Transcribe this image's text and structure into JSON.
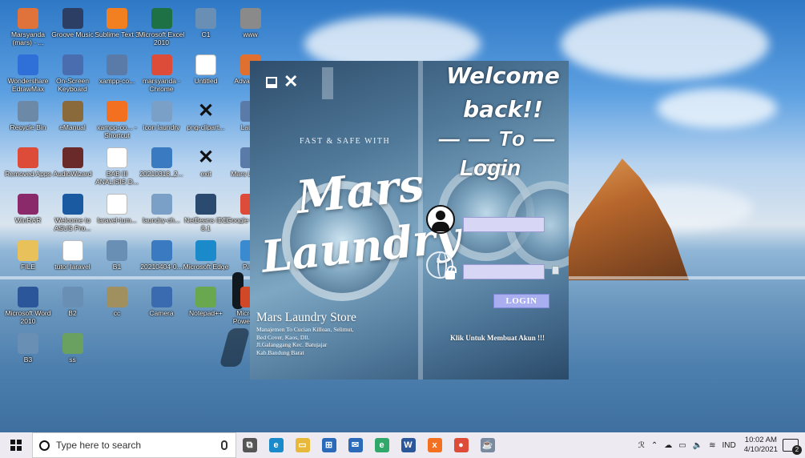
{
  "desktop": {
    "icons": [
      {
        "label": "Marsyanda (mars) - ...",
        "icon": "user-folder-icon",
        "color": "#e0733b"
      },
      {
        "label": "Groove Music",
        "icon": "groove-music-icon",
        "color": "#2c3e63"
      },
      {
        "label": "Sublime Text 3",
        "icon": "sublime-text-icon",
        "color": "#f38020"
      },
      {
        "label": "Microsoft Excel 2010",
        "icon": "excel-icon",
        "color": "#1e7145"
      },
      {
        "label": "C1",
        "icon": "document-icon",
        "color": "#6a8fb5"
      },
      {
        "label": "www",
        "icon": "folder-icon",
        "color": "#8a8a8a"
      },
      {
        "label": "Wondershare EdrawMax",
        "icon": "edrawmax-icon",
        "color": "#2f6fd8"
      },
      {
        "label": "On-Screen Keyboard",
        "icon": "keyboard-icon",
        "color": "#4a6db0"
      },
      {
        "label": "xampp-co...",
        "icon": "shortcut-icon",
        "color": "#5a7aa8"
      },
      {
        "label": "marsyanda - Chrome",
        "icon": "chrome-icon",
        "color": "#dd4b39"
      },
      {
        "label": "Untitled",
        "icon": "blank-document-icon",
        "color": "#ffffff"
      },
      {
        "label": "Adva Insta",
        "icon": "installer-icon",
        "color": "#e07030"
      },
      {
        "label": "Recycle Bin",
        "icon": "recycle-bin-icon",
        "color": "#6c8aa8"
      },
      {
        "label": "eManual",
        "icon": "manual-icon",
        "color": "#8a6a3a"
      },
      {
        "label": "xampp-co... - Shortcut",
        "icon": "xampp-icon",
        "color": "#f37021"
      },
      {
        "label": "icon laundry",
        "icon": "image-icon",
        "color": "#7aa0c8"
      },
      {
        "label": "png-clipart...",
        "icon": "close-x-icon",
        "color": "#111111"
      },
      {
        "label": "Laund",
        "icon": "folder-icon",
        "color": "#5a7aa8"
      },
      {
        "label": "Removed Apps",
        "icon": "chrome-icon",
        "color": "#dd4b39"
      },
      {
        "label": "AudioWizard",
        "icon": "audio-icon",
        "color": "#6b2a2a"
      },
      {
        "label": "BAB III ANALISIS D...",
        "icon": "pdf-icon",
        "color": "#ffffff"
      },
      {
        "label": "20210318_2...",
        "icon": "zip-icon",
        "color": "#3a7ac0"
      },
      {
        "label": "exit",
        "icon": "close-x-icon",
        "color": "#111111"
      },
      {
        "label": "Mars L - Sho",
        "icon": "shortcut-icon",
        "color": "#5a7aa8"
      },
      {
        "label": "WinRAR",
        "icon": "winrar-icon",
        "color": "#8a2a6a"
      },
      {
        "label": "Welcome to ASUS Pro...",
        "icon": "asus-icon",
        "color": "#1a5aa0"
      },
      {
        "label": "laravel-tum...",
        "icon": "pdf-icon",
        "color": "#ffffff"
      },
      {
        "label": "laundry-ch...",
        "icon": "image-icon",
        "color": "#7aa0c8"
      },
      {
        "label": "NetBeans IDE 8.1",
        "icon": "netbeans-icon",
        "color": "#2a4a70"
      },
      {
        "label": "Google Chrome",
        "icon": "chrome-icon",
        "color": "#dd4b39"
      },
      {
        "label": "FILE",
        "icon": "folder-icon",
        "color": "#e8c15a"
      },
      {
        "label": "tutor laravel",
        "icon": "document-icon",
        "color": "#ffffff"
      },
      {
        "label": "B1",
        "icon": "document-icon",
        "color": "#6a8fb5"
      },
      {
        "label": "20210404-0...",
        "icon": "zip-icon",
        "color": "#3a7ac0"
      },
      {
        "label": "Microsoft Edge",
        "icon": "edge-icon",
        "color": "#1a8acb"
      },
      {
        "label": "Paint",
        "icon": "paint-icon",
        "color": "#3a8ad0"
      },
      {
        "label": "Microsoft Word 2010",
        "icon": "word-icon",
        "color": "#2b579a"
      },
      {
        "label": "B2",
        "icon": "document-icon",
        "color": "#6a8fb5"
      },
      {
        "label": "cc",
        "icon": "image-icon",
        "color": "#a09060"
      },
      {
        "label": "Camera",
        "icon": "camera-icon",
        "color": "#3a6ab0"
      },
      {
        "label": "Notepad++",
        "icon": "notepad-icon",
        "color": "#6aa84f"
      },
      {
        "label": "Microsoft PowerPoi...",
        "icon": "powerpoint-icon",
        "color": "#d24726"
      },
      {
        "label": "B3",
        "icon": "document-icon",
        "color": "#6a8fb5"
      },
      {
        "label": "ss",
        "icon": "image-icon",
        "color": "#6aa060"
      }
    ]
  },
  "login": {
    "tagline": "FAST & SAFE WITH",
    "brand_line1": "Mars",
    "brand_line2": "Laundry",
    "welcome_line1": "Welcome",
    "welcome_line2": "back!!",
    "to_line": "— — To — —",
    "login_word": "Login",
    "username_value": "",
    "password_value": "",
    "login_button": "LOGIN",
    "store_title": "Mars Laundry Store",
    "store_description": "Manajemen To Cucian Killoan, Selimut,\nBed Cover, Kaos, Dll.\nJl.Galanggang Kec. Batujajar\nKab.Bandung Barat",
    "signup_link": "Klik Untuk Membuat Akun !!!",
    "accent_color": "#a9aef1",
    "field_color": "#d7d6f5"
  },
  "taskbar": {
    "search_placeholder": "Type here to search",
    "apps": [
      {
        "icon": "task-view-icon",
        "label": "⧉",
        "color": "#555555"
      },
      {
        "icon": "edge-icon",
        "label": "e",
        "color": "#1a8acb"
      },
      {
        "icon": "file-explorer-icon",
        "label": "▭",
        "color": "#e8b83a"
      },
      {
        "icon": "store-icon",
        "label": "⊞",
        "color": "#2a6ab8"
      },
      {
        "icon": "mail-icon",
        "label": "✉",
        "color": "#2a6ab8"
      },
      {
        "icon": "edge-browser-icon",
        "label": "e",
        "color": "#2fa86a"
      },
      {
        "icon": "word-icon",
        "label": "W",
        "color": "#2b579a"
      },
      {
        "icon": "xampp-icon",
        "label": "x",
        "color": "#f37021"
      },
      {
        "icon": "chrome-icon",
        "label": "●",
        "color": "#dd4b39"
      },
      {
        "icon": "java-app-icon",
        "label": "☕",
        "color": "#7a8aa0"
      }
    ],
    "tray_language": "IND",
    "time": "10:02 AM",
    "date": "4/10/2021",
    "notification_count": "2"
  }
}
